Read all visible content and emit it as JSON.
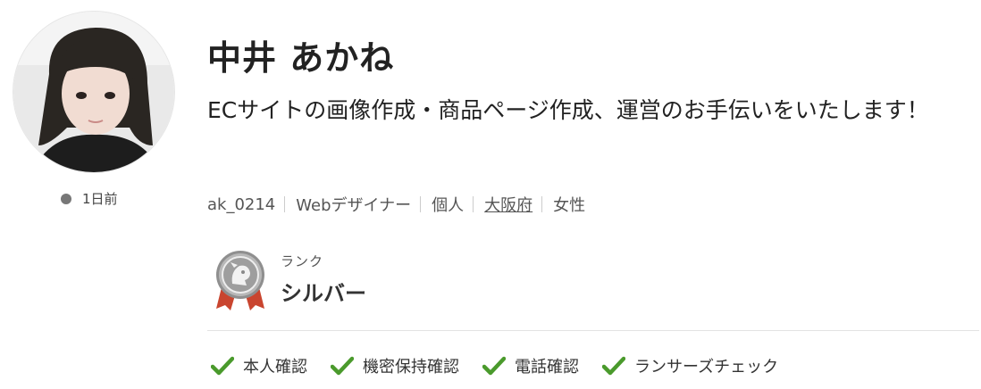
{
  "profile": {
    "name": "中井 あかね",
    "catchphrase": "ECサイトの画像作成・商品ページ作成、運営のお手伝いをいたします！",
    "last_login": "1日前"
  },
  "meta": {
    "user_id": "ak_0214",
    "occupation": "Webデザイナー",
    "type": "個人",
    "prefecture": "大阪府",
    "gender": "女性"
  },
  "rank": {
    "label": "ランク",
    "value": "シルバー",
    "badge_icon": "silver-rank-medal-icon"
  },
  "verifications": [
    {
      "label": "本人確認",
      "icon": "check-icon"
    },
    {
      "label": "機密保持確認",
      "icon": "check-icon"
    },
    {
      "label": "電話確認",
      "icon": "check-icon"
    },
    {
      "label": "ランサーズチェック",
      "icon": "check-icon"
    }
  ],
  "colors": {
    "check_green": "#4a9a2c",
    "status_dot": "#777777",
    "medal_silver": "#9a9a9a",
    "ribbon_red": "#c9452f"
  }
}
